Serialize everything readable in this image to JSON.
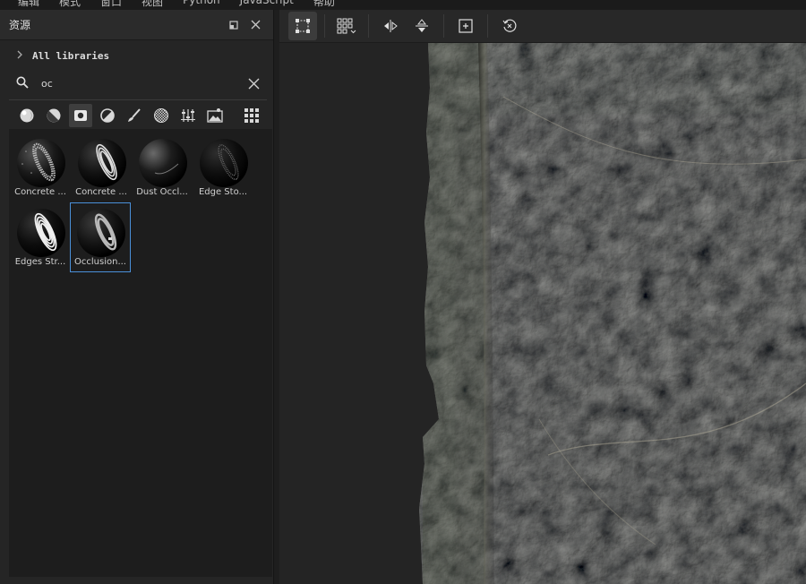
{
  "menubar": {
    "items": [
      "编辑",
      "模式",
      "窗口",
      "视图",
      "Python",
      "JavaScript",
      "帮助"
    ]
  },
  "panel": {
    "title": "资源",
    "library_label": "All libraries",
    "search_value": "oc",
    "filters": [
      "material-ball-icon",
      "material-half-icon",
      "texture-square-icon",
      "filter-icon",
      "brush-icon",
      "pattern-icon",
      "adjustments-icon",
      "environment-icon"
    ],
    "assets": [
      {
        "label": "Concrete ..."
      },
      {
        "label": "Concrete ..."
      },
      {
        "label": "Dust Occl..."
      },
      {
        "label": "Edge Sto..."
      },
      {
        "label": "Edges Str..."
      },
      {
        "label": "Occlusion..."
      }
    ],
    "selected_asset": "Occlusion..."
  },
  "viewport": {
    "tools": [
      "uv-select-icon",
      "grid-tiling-icon",
      "flip-horizontal-icon",
      "flip-vertical-icon",
      "fit-icon",
      "reset-icon"
    ]
  }
}
